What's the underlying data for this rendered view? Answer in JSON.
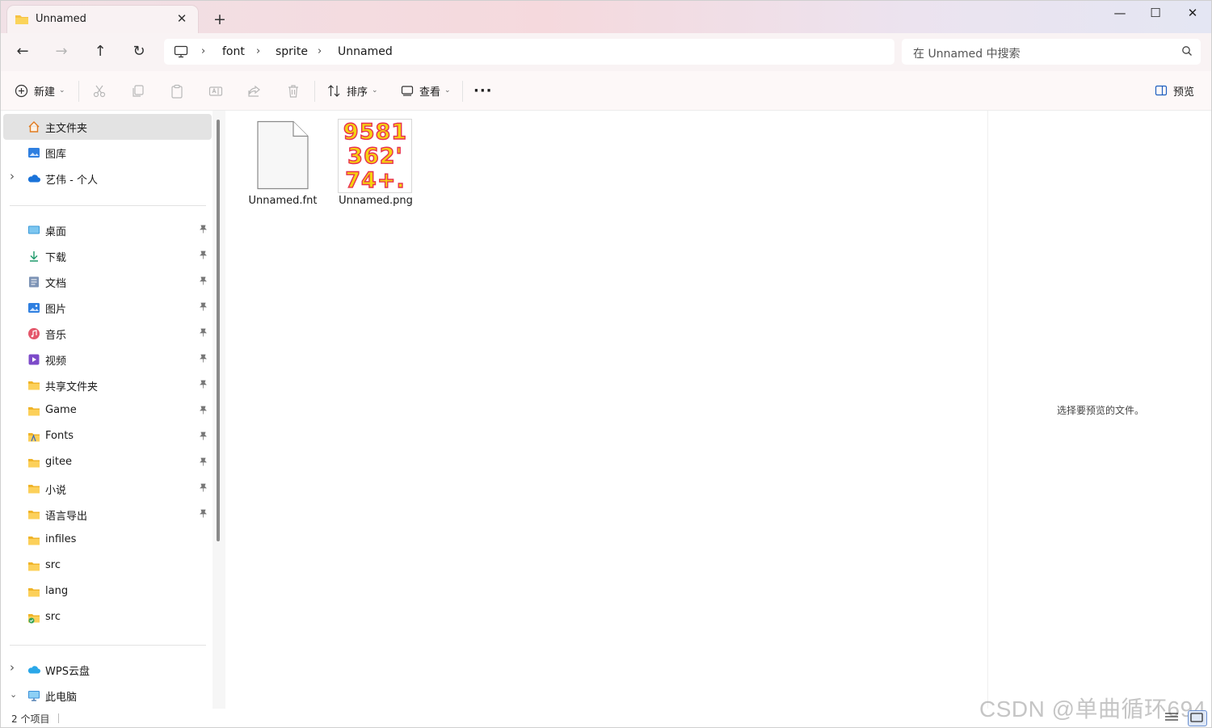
{
  "window": {
    "tab_title": "Unnamed",
    "new_tab_symbol": "+",
    "close_tab_symbol": "✕",
    "controls": {
      "minimize": "—",
      "maximize": "☐",
      "close": "✕"
    }
  },
  "nav": {
    "back": "←",
    "forward": "→",
    "up": "↑",
    "refresh": "↻",
    "breadcrumb": [
      "font",
      "sprite",
      "Unnamed"
    ],
    "search_placeholder": "在 Unnamed 中搜索"
  },
  "toolbar": {
    "new_label": "新建",
    "sort_label": "排序",
    "view_label": "查看",
    "more_label": "···",
    "preview_label": "预览",
    "icons": [
      "cut-icon",
      "copy-icon",
      "paste-icon",
      "rename-icon",
      "share-icon",
      "delete-icon"
    ]
  },
  "sidebar": {
    "top": [
      {
        "label": "主文件夹",
        "icon": "home-icon",
        "selected": true
      },
      {
        "label": "图库",
        "icon": "gallery-icon"
      },
      {
        "label": "艺伟 - 个人",
        "icon": "onedrive-icon",
        "expandable": true
      }
    ],
    "quick_access": [
      {
        "label": "桌面",
        "icon": "desktop-icon",
        "pinned": true
      },
      {
        "label": "下载",
        "icon": "download-icon",
        "pinned": true
      },
      {
        "label": "文档",
        "icon": "documents-icon",
        "pinned": true
      },
      {
        "label": "图片",
        "icon": "pictures-icon",
        "pinned": true
      },
      {
        "label": "音乐",
        "icon": "music-icon",
        "pinned": true
      },
      {
        "label": "视频",
        "icon": "videos-icon",
        "pinned": true
      },
      {
        "label": "共享文件夹",
        "icon": "folder-icon",
        "pinned": true
      },
      {
        "label": "Game",
        "icon": "folder-icon",
        "pinned": true
      },
      {
        "label": "Fonts",
        "icon": "fonts-folder-icon",
        "pinned": true
      },
      {
        "label": "gitee",
        "icon": "folder-icon",
        "pinned": true
      },
      {
        "label": "小说",
        "icon": "folder-icon",
        "pinned": true
      },
      {
        "label": "语言导出",
        "icon": "folder-icon",
        "pinned": true
      },
      {
        "label": "infiles",
        "icon": "folder-icon"
      },
      {
        "label": "src",
        "icon": "folder-icon"
      },
      {
        "label": "lang",
        "icon": "folder-icon"
      },
      {
        "label": "src",
        "icon": "git-folder-icon"
      }
    ],
    "bottom": [
      {
        "label": "WPS云盘",
        "icon": "wps-cloud-icon",
        "expandable": true,
        "expanded": false
      },
      {
        "label": "此电脑",
        "icon": "this-pc-icon",
        "expandable": true,
        "expanded": true
      }
    ],
    "pin_symbol": "📌",
    "chevron_right": "›",
    "chevron_down": "⌄"
  },
  "files": [
    {
      "name": "Unnamed.fnt",
      "type": "fnt"
    },
    {
      "name": "Unnamed.png",
      "type": "png",
      "thumbnail_rows": [
        "9581",
        "362'",
        "74+."
      ]
    }
  ],
  "preview_pane": {
    "message": "选择要预览的文件。"
  },
  "status": {
    "item_count": "2 个项目"
  },
  "watermark": "CSDN @单曲循环694",
  "colors": {
    "folder_yellow": "#f6c244",
    "accent_blue": "#0a64c8",
    "thumbnail_fill": "#f5d10f",
    "thumbnail_outline": "#e8314f"
  }
}
